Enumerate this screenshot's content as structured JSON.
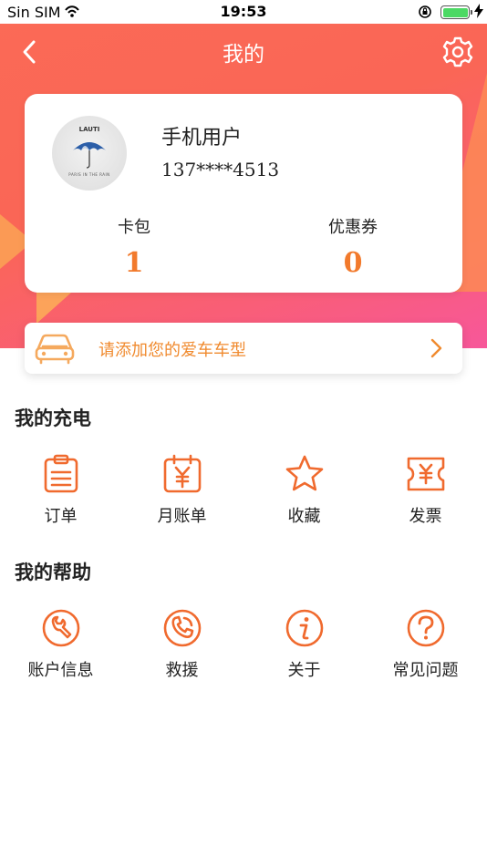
{
  "status_bar": {
    "carrier": "Sin SIM",
    "time": "19:53"
  },
  "nav": {
    "title": "我的"
  },
  "profile": {
    "name": "手机用户",
    "phone": "137****4513",
    "avatar_title": "LAUTI",
    "avatar_footer": "PARIS IN THE RAIN",
    "stats": [
      {
        "label": "卡包",
        "value": "1"
      },
      {
        "label": "优惠券",
        "value": "0"
      }
    ]
  },
  "car_banner": {
    "text": "请添加您的爱车车型"
  },
  "sections": [
    {
      "title": "我的充电",
      "items": [
        {
          "label": "订单",
          "icon": "clipboard-icon"
        },
        {
          "label": "月账单",
          "icon": "calendar-yen-icon"
        },
        {
          "label": "收藏",
          "icon": "star-icon"
        },
        {
          "label": "发票",
          "icon": "ticket-yen-icon"
        }
      ]
    },
    {
      "title": "我的帮助",
      "items": [
        {
          "label": "账户信息",
          "icon": "wrench-icon"
        },
        {
          "label": "救援",
          "icon": "phone-icon"
        },
        {
          "label": "关于",
          "icon": "info-icon"
        },
        {
          "label": "常见问题",
          "icon": "question-icon"
        }
      ]
    }
  ],
  "colors": {
    "accent": "#f06a2e",
    "header_gradient_start": "#fb6a56",
    "header_gradient_end": "#f7579a",
    "stat_value": "#f27a2c",
    "battery": "#4cd964"
  }
}
